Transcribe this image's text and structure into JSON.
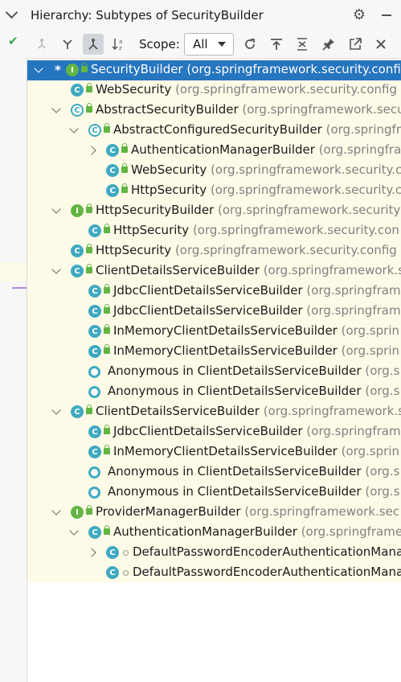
{
  "header": {
    "title_prefix": "Hierarchy:",
    "title_text": "Subtypes of SecurityBuilder"
  },
  "toolbar": {
    "scope_label": "Scope:",
    "scope_value": "All"
  },
  "tree": [
    {
      "depth": 0,
      "arrow": "down",
      "icon": "i",
      "lock": true,
      "name": "SecurityBuilder",
      "pkg": "(org.springframework.security.config",
      "selected": true,
      "star": "*"
    },
    {
      "depth": 1,
      "arrow": "",
      "icon": "c",
      "lock": true,
      "name": "WebSecurity",
      "pkg": "(org.springframework.security.config"
    },
    {
      "depth": 1,
      "arrow": "down",
      "icon": "ca",
      "lock": true,
      "name": "AbstractSecurityBuilder",
      "pkg": "(org.springframework.security.secu"
    },
    {
      "depth": 2,
      "arrow": "down",
      "icon": "ca",
      "lock": true,
      "name": "AbstractConfiguredSecurityBuilder",
      "pkg": "(org.springframe"
    },
    {
      "depth": 3,
      "arrow": "right",
      "icon": "c",
      "lock": true,
      "name": "AuthenticationManagerBuilder",
      "pkg": "(org.springfra"
    },
    {
      "depth": 3,
      "arrow": "",
      "icon": "c",
      "lock": true,
      "name": "WebSecurity",
      "pkg": "(org.springframework.security.c"
    },
    {
      "depth": 3,
      "arrow": "",
      "icon": "c",
      "lock": true,
      "name": "HttpSecurity",
      "pkg": "(org.springframework.security.c"
    },
    {
      "depth": 1,
      "arrow": "down",
      "icon": "i",
      "lock": true,
      "name": "HttpSecurityBuilder",
      "pkg": "(org.springframework.security"
    },
    {
      "depth": 2,
      "arrow": "",
      "icon": "c",
      "lock": true,
      "name": "HttpSecurity",
      "pkg": "(org.springframework.security.con"
    },
    {
      "depth": 1,
      "arrow": "",
      "icon": "c",
      "lock": true,
      "name": "HttpSecurity",
      "pkg": "(org.springframework.security.config"
    },
    {
      "depth": 1,
      "arrow": "down",
      "icon": "c",
      "lock": true,
      "name": "ClientDetailsServiceBuilder",
      "pkg": "(org.springframework.s"
    },
    {
      "depth": 2,
      "arrow": "",
      "icon": "c",
      "lock": true,
      "name": "JdbcClientDetailsServiceBuilder",
      "pkg": "(org.springfram"
    },
    {
      "depth": 2,
      "arrow": "",
      "icon": "c",
      "lock": true,
      "name": "JdbcClientDetailsServiceBuilder",
      "pkg": "(org.springfram"
    },
    {
      "depth": 2,
      "arrow": "",
      "icon": "c",
      "lock": true,
      "name": "InMemoryClientDetailsServiceBuilder",
      "pkg": "(org.sprin"
    },
    {
      "depth": 2,
      "arrow": "",
      "icon": "c",
      "lock": true,
      "name": "InMemoryClientDetailsServiceBuilder",
      "pkg": "(org.sprin"
    },
    {
      "depth": 2,
      "arrow": "",
      "icon": "anon",
      "lock": false,
      "name": "Anonymous in ClientDetailsServiceBuilder",
      "pkg": "(org.s"
    },
    {
      "depth": 2,
      "arrow": "",
      "icon": "anon",
      "lock": false,
      "name": "Anonymous in ClientDetailsServiceBuilder",
      "pkg": "(org.s"
    },
    {
      "depth": 1,
      "arrow": "down",
      "icon": "c",
      "lock": true,
      "name": "ClientDetailsServiceBuilder",
      "pkg": "(org.springframework.s"
    },
    {
      "depth": 2,
      "arrow": "",
      "icon": "c",
      "lock": true,
      "name": "JdbcClientDetailsServiceBuilder",
      "pkg": "(org.springfram"
    },
    {
      "depth": 2,
      "arrow": "",
      "icon": "c",
      "lock": true,
      "name": "InMemoryClientDetailsServiceBuilder",
      "pkg": "(org.sprin"
    },
    {
      "depth": 2,
      "arrow": "",
      "icon": "anon",
      "lock": false,
      "name": "Anonymous in ClientDetailsServiceBuilder",
      "pkg": "(org.s"
    },
    {
      "depth": 2,
      "arrow": "",
      "icon": "anon",
      "lock": false,
      "name": "Anonymous in ClientDetailsServiceBuilder",
      "pkg": "(org.s"
    },
    {
      "depth": 1,
      "arrow": "down",
      "icon": "i",
      "lock": true,
      "name": "ProviderManagerBuilder",
      "pkg": "(org.springframework.sec"
    },
    {
      "depth": 2,
      "arrow": "down",
      "icon": "c",
      "lock": true,
      "name": "AuthenticationManagerBuilder",
      "pkg": "(org.springframe"
    },
    {
      "depth": 3,
      "arrow": "right",
      "icon": "c",
      "lock": false,
      "dot": true,
      "name": "DefaultPasswordEncoderAuthenticationMana",
      "pkg": ""
    },
    {
      "depth": 3,
      "arrow": "",
      "icon": "c",
      "lock": false,
      "dot": true,
      "name": "DefaultPasswordEncoderAuthenticationMana",
      "pkg": ""
    }
  ]
}
